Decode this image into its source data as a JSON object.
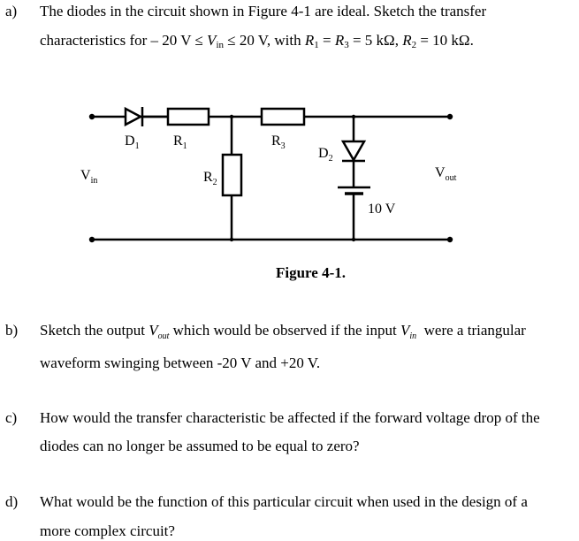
{
  "question_a": {
    "label": "a)",
    "line1": "The diodes in the circuit shown in Figure 4-1 are ideal. Sketch the transfer",
    "line2_pre": "characteristics for – 20 V ≤ ",
    "vin_V": "V",
    "vin_sub": "in",
    "line2_mid": " ≤ 20 V, with ",
    "r1": "R",
    "r1_sub": "1",
    "eq1": " = ",
    "r3": "R",
    "r3_sub": "3",
    "eq2": " = 5 kΩ, ",
    "r2": "R",
    "r2_sub": "2",
    "eq3": " = 10 kΩ."
  },
  "figure": {
    "caption": "Figure 4-1.",
    "labels": {
      "d1": "D",
      "d1_sub": "1",
      "r1": "R",
      "r1_sub": "1",
      "r2": "R",
      "r2_sub": "2",
      "r3": "R",
      "r3_sub": "3",
      "d2": "D",
      "d2_sub": "2",
      "vin": "V",
      "vin_sub": "in",
      "vout": "V",
      "vout_sub": "out",
      "battery": "10 V"
    }
  },
  "question_b": {
    "label": "b)",
    "line1_pre": "Sketch the output ",
    "vout_V": "V",
    "vout_sub": "out",
    "line1_mid": " which would be observed if the input ",
    "vin_V": "V",
    "vin_sub": "in",
    "line1_post": "  were a triangular",
    "line2": "waveform swinging between -20 V and +20 V."
  },
  "question_c": {
    "label": "c)",
    "line1": "How would the transfer characteristic be affected if the forward voltage drop of the",
    "line2": "diodes can no longer be assumed to be equal to zero?"
  },
  "question_d": {
    "label": "d)",
    "line1": "What would be the function of this particular circuit when used in the design of a",
    "line2": "more complex circuit?"
  }
}
